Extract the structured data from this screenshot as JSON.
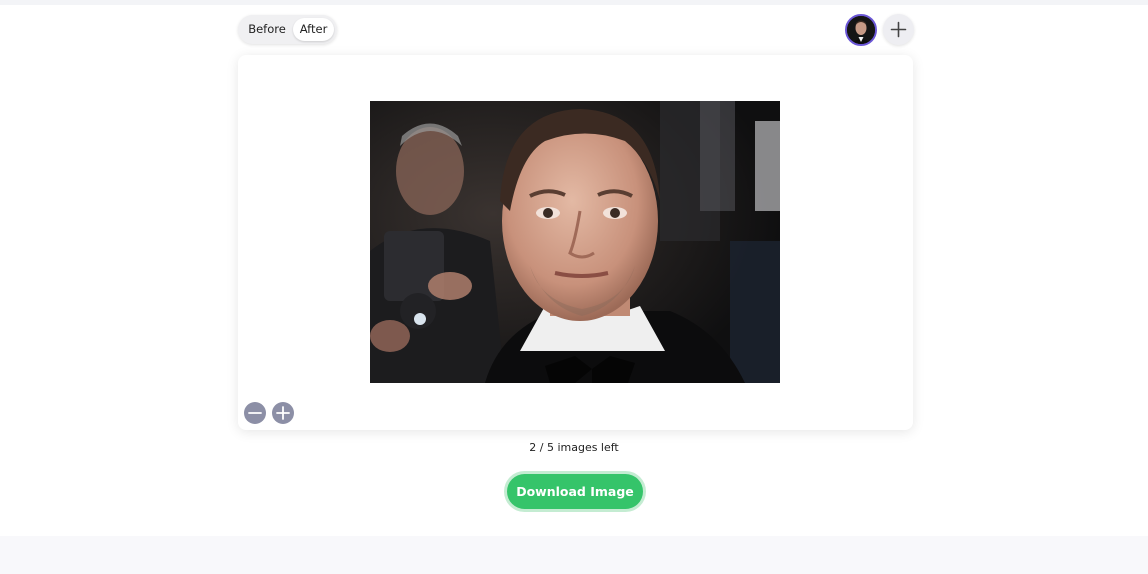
{
  "view_toggle": {
    "before_label": "Before",
    "after_label": "After",
    "selected": "After"
  },
  "images": {
    "thumbnail_icon": "portrait-thumbnail",
    "add_icon": "plus-icon"
  },
  "preview": {
    "image_subject": "portrait-photo",
    "zoom_out_icon": "minus-icon",
    "zoom_in_icon": "plus-icon"
  },
  "quota": {
    "text": "2 / 5 images left"
  },
  "actions": {
    "download_label": "Download Image"
  },
  "colors": {
    "accent": "#35c46a",
    "thumbnail_ring": "#6b57d6",
    "zoom_buttons": "#8c8fa6"
  }
}
